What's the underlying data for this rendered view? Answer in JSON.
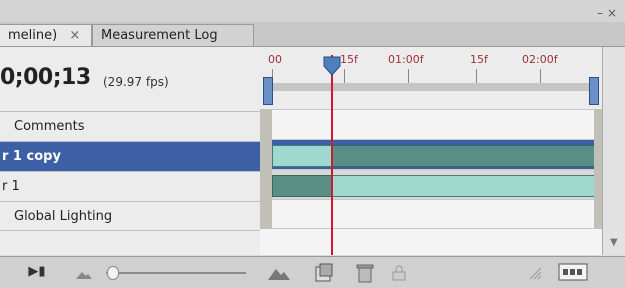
{
  "tabs": {
    "active_label": "meline)",
    "active_close": "×",
    "inactive_label": "Measurement Log"
  },
  "window": {
    "controls": "– ×",
    "menu": "▾≡"
  },
  "header": {
    "timecode": "0;00;13",
    "fps": "(29.97 fps)"
  },
  "ruler": {
    "labels": [
      "00",
      "15f",
      "01:00f",
      "15f",
      "02:00f"
    ]
  },
  "layers": [
    {
      "label": "Comments",
      "selected": false
    },
    {
      "label": "r 1 copy",
      "selected": true
    },
    {
      "label": "r 1",
      "selected": false
    },
    {
      "label": "Global Lighting",
      "selected": false
    }
  ],
  "bottom": {
    "play_label": "▶▮",
    "zoom_out_icon": "mountain-small-icon",
    "zoom_in_icon": "mountain-large-icon",
    "new_layer_icon": "new-layer-icon",
    "delete_icon": "trash-icon",
    "panel_menu_icon": "panel-menu-icon"
  },
  "colors": {
    "accent_selected": "#3d5fa6",
    "playhead": "#d01830",
    "bar_light": "#9fd8cc",
    "bar_dark": "#5a8f86"
  }
}
